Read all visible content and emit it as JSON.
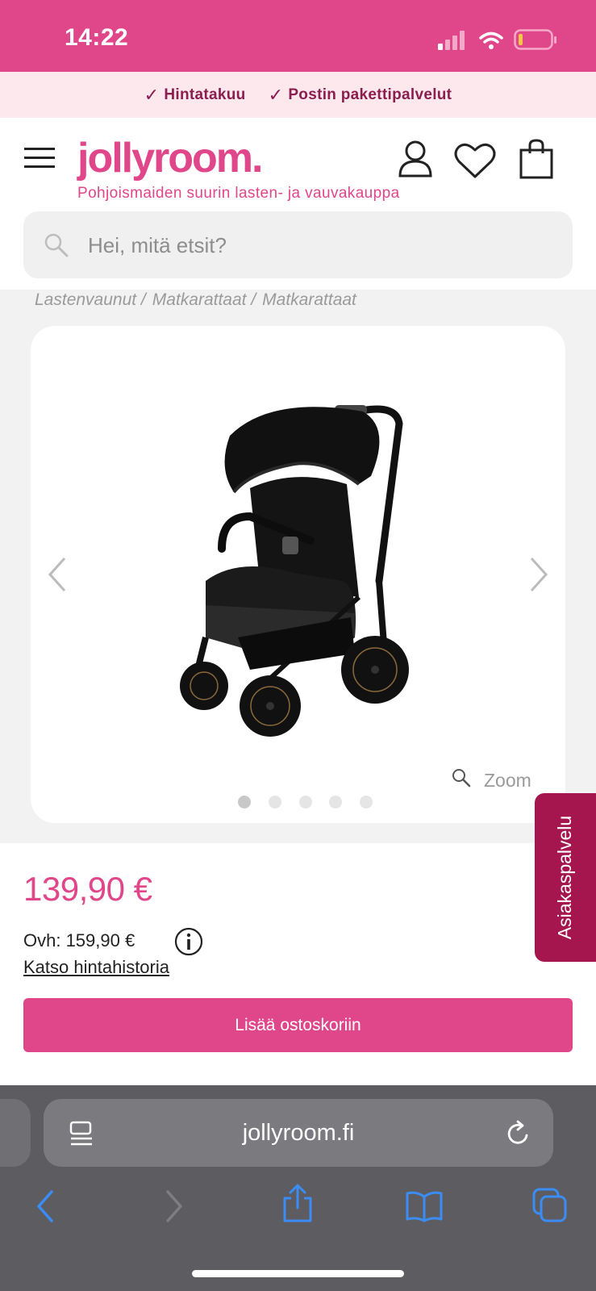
{
  "status_bar": {
    "time": "14:22"
  },
  "usp": [
    {
      "label": "Hintatakuu"
    },
    {
      "label": "Postin pakettipalvelut"
    }
  ],
  "header": {
    "logo": "jollyroom.",
    "tagline": "Pohjoismaiden suurin lasten- ja vauvakauppa",
    "icons": [
      "menu-icon",
      "account-icon",
      "wishlist-heart-icon",
      "shopping-bag-icon"
    ]
  },
  "search": {
    "placeholder": "Hei, mitä etsit?"
  },
  "breadcrumb": [
    "Lastenvaunut /",
    "Matkarattaat /",
    "Matkarattaat"
  ],
  "gallery": {
    "zoom_label": "Zoom",
    "dot_count": 5,
    "active_dot": 1
  },
  "product": {
    "price": "139,90 €",
    "old_price": "Ovh: 159,90 €",
    "history_link": "Katso hintahistoria",
    "add_to_cart": "Lisää ostoskoriin"
  },
  "support_tab": {
    "label": "Asiakaspalvelu"
  },
  "browser": {
    "url": "jollyroom.fi",
    "toolbar_icons": [
      "back-icon",
      "forward-icon",
      "share-icon",
      "bookmarks-icon",
      "tabs-icon"
    ]
  },
  "colors": {
    "brand_pink": "#e0468a",
    "usp_bg": "#fde8ee",
    "support_tab": "#a5164f",
    "browser_bar": "#5d5d61"
  }
}
